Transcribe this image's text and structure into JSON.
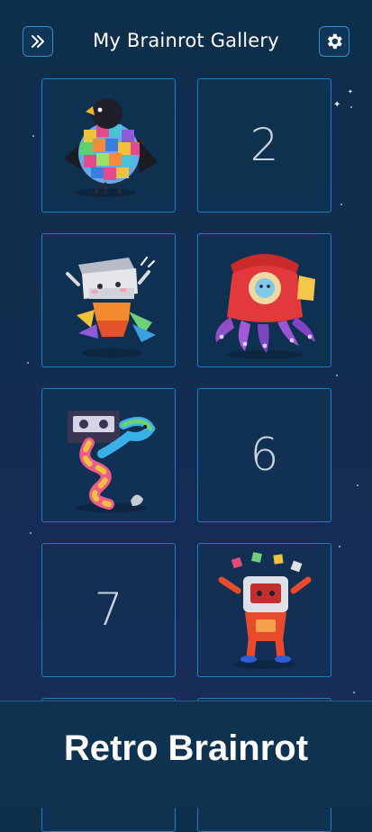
{
  "header": {
    "title": "My Brainrot Gallery",
    "expand_icon": "double-chevron-right-icon",
    "settings_icon": "gear-icon"
  },
  "gallery": {
    "tiles": [
      {
        "label": "",
        "content": "disco-crow-image"
      },
      {
        "label": "2",
        "content": "empty-slot"
      },
      {
        "label": "",
        "content": "scanner-shrimp-image"
      },
      {
        "label": "",
        "content": "telephone-octopus-image"
      },
      {
        "label": "",
        "content": "cassette-snake-image"
      },
      {
        "label": "6",
        "content": "empty-slot"
      },
      {
        "label": "7",
        "content": "empty-slot"
      },
      {
        "label": "",
        "content": "toaster-robot-image"
      }
    ]
  },
  "footer": {
    "label": "Retro Brainrot"
  },
  "colors": {
    "background_top": "#0e2f4c",
    "background_bottom": "#1b2c5c",
    "accent_border": "#1f7fc4",
    "footer_bg": "#0d3350"
  }
}
